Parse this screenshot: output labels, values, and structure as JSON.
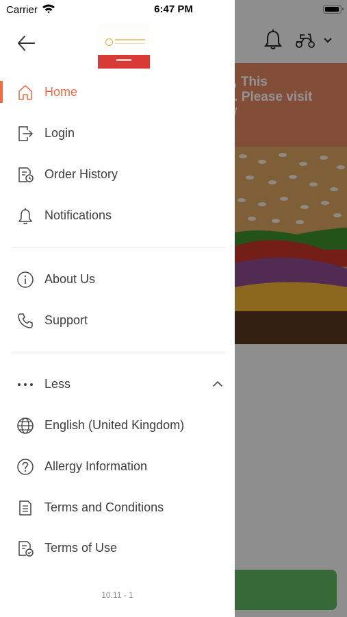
{
  "status_bar": {
    "carrier": "Carrier",
    "time": "6:47 PM"
  },
  "background_app": {
    "banner_text_line1": "ed, This",
    "banner_text_line2": "on. Please visit",
    "banner_color": "#e08760",
    "button_color": "#5fb35f"
  },
  "drawer": {
    "menu": [
      {
        "label": "Home",
        "icon": "home-icon",
        "active": true
      },
      {
        "label": "Login",
        "icon": "login-icon",
        "active": false
      },
      {
        "label": "Order History",
        "icon": "order-history-icon",
        "active": false
      },
      {
        "label": "Notifications",
        "icon": "bell-icon",
        "active": false
      },
      {
        "label": "About Us",
        "icon": "info-icon",
        "active": false
      },
      {
        "label": "Support",
        "icon": "phone-icon",
        "active": false
      },
      {
        "label": "Less",
        "icon": "more-dots-icon",
        "active": false
      },
      {
        "label": "English (United Kingdom)",
        "icon": "globe-icon",
        "active": false
      },
      {
        "label": "Allergy Information",
        "icon": "question-icon",
        "active": false
      },
      {
        "label": "Terms and Conditions",
        "icon": "document-icon",
        "active": false
      },
      {
        "label": "Terms of Use",
        "icon": "document-check-icon",
        "active": false
      }
    ],
    "version": "10.11 - 1",
    "accent_color": "#ee6c45"
  }
}
